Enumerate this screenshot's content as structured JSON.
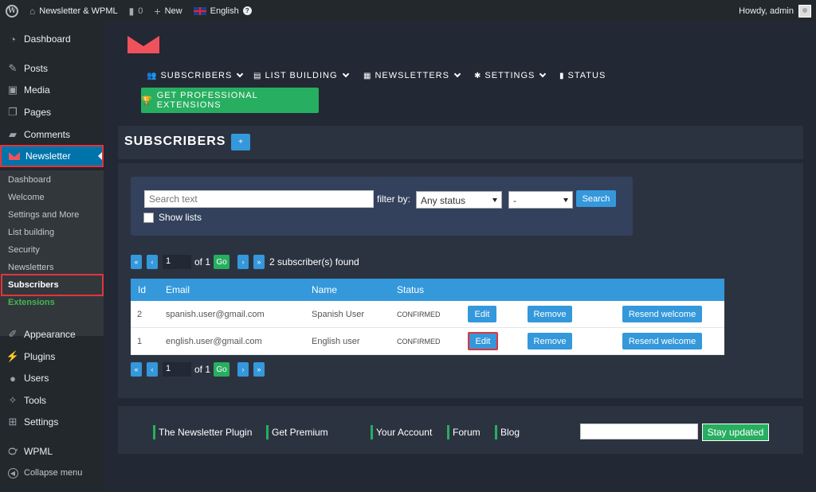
{
  "adminbar": {
    "site_name": "Newsletter & WPML",
    "comments_count": "0",
    "new_label": "New",
    "language": "English",
    "greeting": "Howdy, admin"
  },
  "sidebar": {
    "items": [
      {
        "label": "Dashboard",
        "icon": "dashboard-icon"
      },
      {
        "label": "Posts",
        "icon": "pin-icon"
      },
      {
        "label": "Media",
        "icon": "media-icon"
      },
      {
        "label": "Pages",
        "icon": "pages-icon"
      },
      {
        "label": "Comments",
        "icon": "comment-icon"
      },
      {
        "label": "Newsletter",
        "icon": "newsletter-icon"
      },
      {
        "label": "Appearance",
        "icon": "brush-icon"
      },
      {
        "label": "Plugins",
        "icon": "plug-icon"
      },
      {
        "label": "Users",
        "icon": "user-icon"
      },
      {
        "label": "Tools",
        "icon": "wrench-icon"
      },
      {
        "label": "Settings",
        "icon": "settings-icon"
      },
      {
        "label": "WPML",
        "icon": "wpml-icon"
      }
    ],
    "collapse_label": "Collapse menu",
    "submenu": [
      "Dashboard",
      "Welcome",
      "Settings and More",
      "List building",
      "Security",
      "Newsletters",
      "Subscribers",
      "Extensions"
    ]
  },
  "topnav": {
    "items": [
      "SUBSCRIBERS",
      "LIST BUILDING",
      "NEWSLETTERS",
      "SETTINGS",
      "STATUS"
    ],
    "pro_button": "GET PROFESSIONAL EXTENSIONS"
  },
  "page": {
    "title": "SUBSCRIBERS",
    "add_label": "+"
  },
  "filters": {
    "search_placeholder": "Search text",
    "filter_by": "filter by:",
    "status_value": "Any status",
    "list_value": "-",
    "search_button": "Search",
    "show_lists": "Show lists"
  },
  "pager": {
    "first": "«",
    "prev": "‹",
    "page": "1",
    "of": "of 1",
    "go": "Go",
    "next": "›",
    "last": "»",
    "found": "2 subscriber(s) found"
  },
  "table": {
    "headers": [
      "Id",
      "Email",
      "Name",
      "Status"
    ],
    "rows": [
      {
        "id": "2",
        "email": "spanish.user@gmail.com",
        "name": "Spanish User",
        "status": "CONFIRMED"
      },
      {
        "id": "1",
        "email": "english.user@gmail.com",
        "name": "English user",
        "status": "CONFIRMED"
      }
    ],
    "edit_label": "Edit",
    "remove_label": "Remove",
    "resend_label": "Resend welcome"
  },
  "footer": {
    "links": [
      "The Newsletter Plugin",
      "Get Premium",
      "Your Account",
      "Forum",
      "Blog"
    ],
    "stay_updated": "Stay updated"
  },
  "colors": {
    "accent_blue": "#3498db",
    "accent_green": "#27ae60",
    "highlight_red": "#e0353b",
    "wp_active": "#0073aa"
  }
}
